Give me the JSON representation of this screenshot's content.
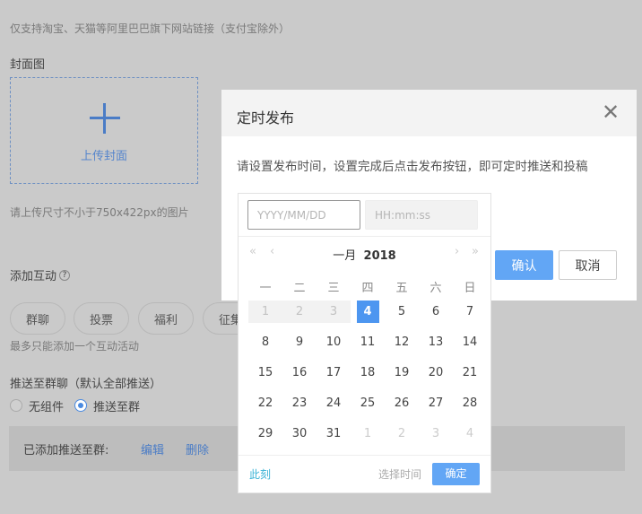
{
  "page": {
    "link_hint": "仅支持淘宝、天猫等阿里巴巴旗下网站链接（支付宝除外）",
    "cover_label": "封面图",
    "upload_label": "上传封面",
    "size_hint": "请上传尺寸不小于750x422px的图片",
    "interaction_label": "添加互动",
    "interactions": [
      "群聊",
      "投票",
      "福利",
      "征集"
    ],
    "interaction_hint": "最多只能添加一个互动活动",
    "push_label": "推送至群聊（默认全部推送）",
    "radio_options": [
      {
        "label": "无组件",
        "checked": false
      },
      {
        "label": "推送至群",
        "checked": true
      }
    ],
    "added_label": "已添加推送至群:",
    "edit_link": "编辑",
    "delete_link": "删除"
  },
  "modal": {
    "title": "定时发布",
    "description": "请设置发布时间，设置完成后点击发布按钮，即可定时推送和投稿",
    "confirm": "确认",
    "cancel": "取消"
  },
  "datepicker": {
    "date_placeholder": "YYYY/MM/DD",
    "time_placeholder": "HH:mm:ss",
    "month": "一月",
    "year": "2018",
    "weekdays": [
      "一",
      "二",
      "三",
      "四",
      "五",
      "六",
      "日"
    ],
    "weeks": [
      [
        "1",
        "2",
        "3",
        "4",
        "5",
        "6",
        "7"
      ],
      [
        "8",
        "9",
        "10",
        "11",
        "12",
        "13",
        "14"
      ],
      [
        "15",
        "16",
        "17",
        "18",
        "19",
        "20",
        "21"
      ],
      [
        "22",
        "23",
        "24",
        "25",
        "26",
        "27",
        "28"
      ],
      [
        "29",
        "30",
        "31",
        "1",
        "2",
        "3",
        "4"
      ]
    ],
    "selected_day": "4",
    "now": "此刻",
    "select_time": "选择时间",
    "ok": "确定"
  },
  "colors": {
    "accent": "#4d96f0",
    "overlay": "#cacaca",
    "link": "#4a7cc6"
  }
}
